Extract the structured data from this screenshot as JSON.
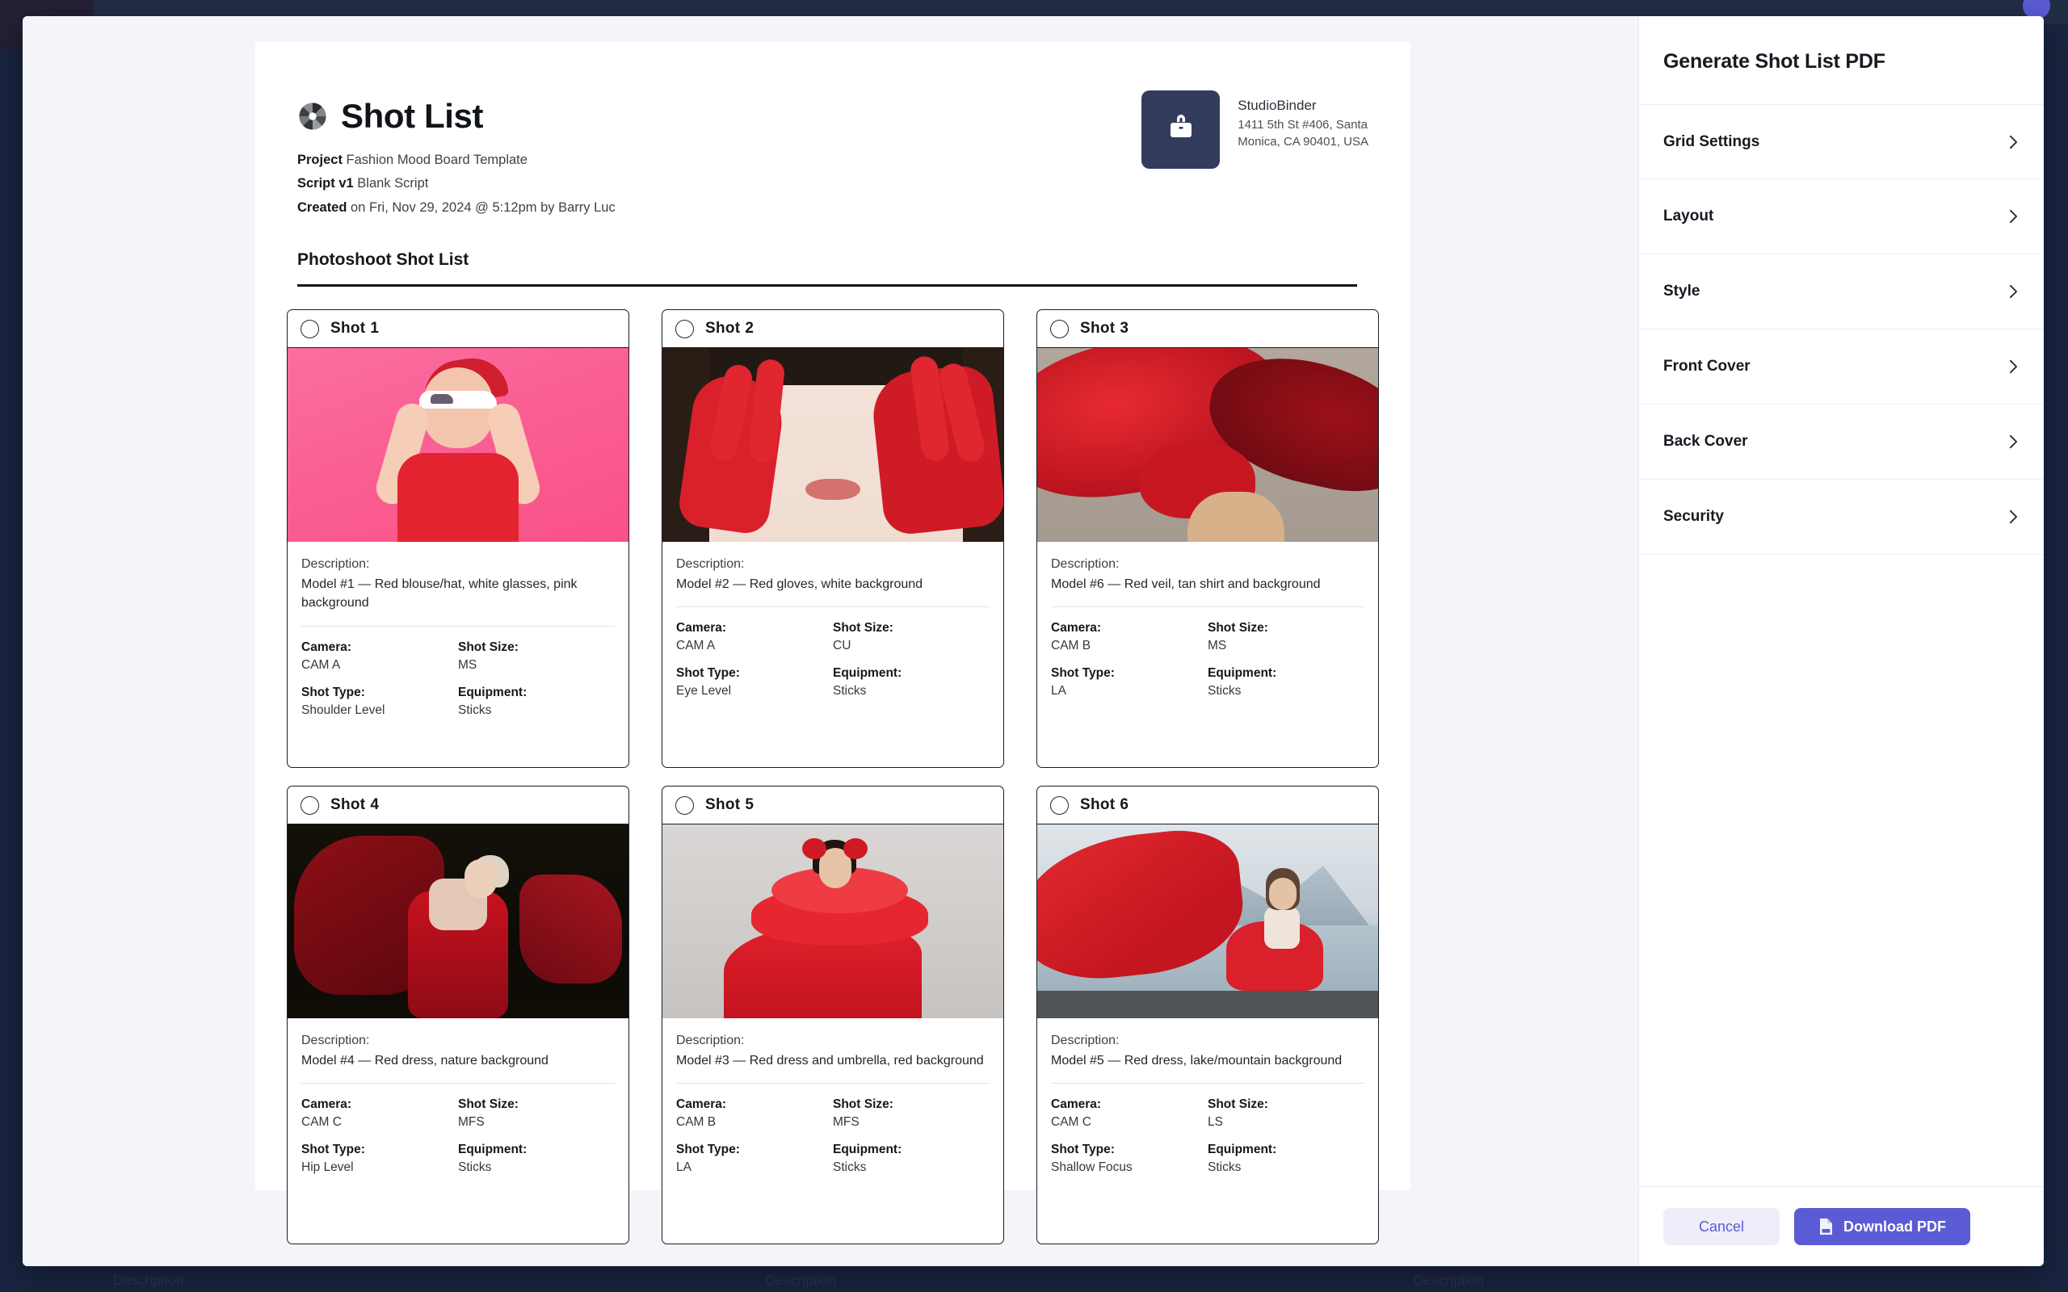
{
  "document": {
    "title": "Shot List",
    "logo_icon": "aperture-icon",
    "meta": [
      {
        "label": "Project",
        "value": "Fashion Mood Board Template"
      },
      {
        "label": "Script v1",
        "value": "Blank Script"
      },
      {
        "label": "Created",
        "value": "on Fri, Nov 29, 2024 @ 5:12pm by Barry Luc"
      }
    ],
    "brand": {
      "icon": "briefcase-icon",
      "name": "StudioBinder",
      "address_line1": "1411 5th St #406, Santa",
      "address_line2": "Monica, CA 90401, USA",
      "logo_color": "#343c5e"
    },
    "section_title": "Photoshoot Shot List",
    "field_labels": {
      "description": "Description:",
      "camera": "Camera:",
      "shot_size": "Shot Size:",
      "shot_type": "Shot Type:",
      "equipment": "Equipment:"
    },
    "shots": [
      {
        "label": "Shot",
        "number": "1",
        "description": "Model #1 — Red blouse/hat, white glasses, pink background",
        "camera": "CAM A",
        "shot_size": "MS",
        "shot_type": "Shoulder Level",
        "equipment": "Sticks",
        "image_alt": "model-red-blouse-pink-background"
      },
      {
        "label": "Shot",
        "number": "2",
        "description": "Model #2 — Red gloves, white background",
        "camera": "CAM A",
        "shot_size": "CU",
        "shot_type": "Eye Level",
        "equipment": "Sticks",
        "image_alt": "model-red-gloves-closeup"
      },
      {
        "label": "Shot",
        "number": "3",
        "description": "Model #6 — Red veil, tan shirt and background",
        "camera": "CAM B",
        "shot_size": "MS",
        "shot_type": "LA",
        "equipment": "Sticks",
        "image_alt": "model-red-veil-tan-background"
      },
      {
        "label": "Shot",
        "number": "4",
        "description": "Model #4 — Red dress, nature background",
        "camera": "CAM C",
        "shot_size": "MFS",
        "shot_type": "Hip Level",
        "equipment": "Sticks",
        "image_alt": "model-red-dress-nature"
      },
      {
        "label": "Shot",
        "number": "5",
        "description": "Model #3 — Red dress and umbrella, red background",
        "camera": "CAM B",
        "shot_size": "MFS",
        "shot_type": "LA",
        "equipment": "Sticks",
        "image_alt": "model-red-tulle-dress"
      },
      {
        "label": "Shot",
        "number": "6",
        "description": "Model #5 — Red dress, lake/mountain background",
        "camera": "CAM C",
        "shot_size": "LS",
        "shot_type": "Shallow Focus",
        "equipment": "Sticks",
        "image_alt": "model-red-dress-lake-mountain"
      }
    ]
  },
  "panel": {
    "title": "Generate Shot List PDF",
    "items": [
      {
        "label": "Grid Settings",
        "chevron": "chevron-right-icon"
      },
      {
        "label": "Layout",
        "chevron": "chevron-right-icon"
      },
      {
        "label": "Style",
        "chevron": "chevron-right-icon"
      },
      {
        "label": "Front Cover",
        "chevron": "chevron-right-icon"
      },
      {
        "label": "Back Cover",
        "chevron": "chevron-right-icon"
      },
      {
        "label": "Security",
        "chevron": "chevron-right-icon"
      }
    ],
    "footer": {
      "cancel_label": "Cancel",
      "download_label": "Download PDF",
      "download_icon": "pdf-file-icon",
      "accent_color": "#5b5bd6",
      "cancel_bg": "#eeeefb"
    }
  },
  "background": {
    "ghost_text": "Description",
    "overlay_color": "#192440"
  }
}
